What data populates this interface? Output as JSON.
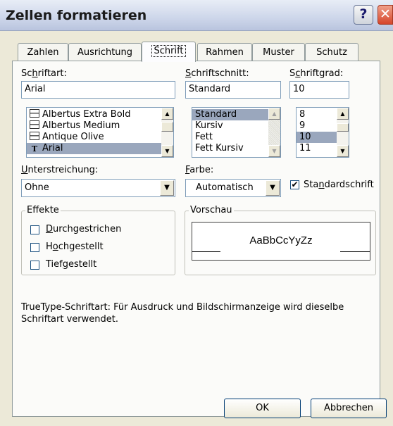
{
  "window": {
    "title": "Zellen formatieren",
    "help_glyph": "?",
    "close_glyph": "✕"
  },
  "tabs": [
    {
      "label": "Zahlen"
    },
    {
      "label": "Ausrichtung"
    },
    {
      "label": "Schrift",
      "active": true
    },
    {
      "label": "Rahmen"
    },
    {
      "label": "Muster"
    },
    {
      "label": "Schutz"
    }
  ],
  "font": {
    "label_pre": "Sc",
    "label_key": "h",
    "label_post": "riftart:",
    "value": "Arial",
    "items": [
      {
        "name": "Albertus Extra Bold",
        "icon": "printer-font-icon"
      },
      {
        "name": "Albertus Medium",
        "icon": "printer-font-icon"
      },
      {
        "name": "Antique Olive",
        "icon": "printer-font-icon"
      },
      {
        "name": "Arial",
        "icon": "truetype-font-icon",
        "selected": true
      }
    ]
  },
  "style": {
    "label_pre": "",
    "label_key": "S",
    "label_post": "chriftschnitt:",
    "value": "Standard",
    "items": [
      {
        "name": "Standard",
        "selected": true
      },
      {
        "name": "Kursiv"
      },
      {
        "name": "Fett"
      },
      {
        "name": "Fett Kursiv"
      }
    ]
  },
  "size": {
    "label_pre": "S",
    "label_key": "c",
    "label_post": "hriftgrad:",
    "value": "10",
    "items": [
      {
        "name": "8"
      },
      {
        "name": "9"
      },
      {
        "name": "10",
        "selected": true
      },
      {
        "name": "11"
      }
    ]
  },
  "underline": {
    "label_pre": "",
    "label_key": "U",
    "label_post": "nterstreichung:",
    "value": "Ohne"
  },
  "color": {
    "label_pre": "",
    "label_key": "F",
    "label_post": "arbe:",
    "value": "Automatisch"
  },
  "standard_font": {
    "label_pre": "Sta",
    "label_key": "n",
    "label_post": "dardschrift",
    "checked": true
  },
  "effects": {
    "title": "Effekte",
    "items": [
      {
        "label_pre": "",
        "label_key": "D",
        "label_post": "urchgestrichen",
        "checked": false
      },
      {
        "label_pre": "H",
        "label_key": "o",
        "label_post": "chgestellt",
        "checked": false
      },
      {
        "label_pre": "Tief",
        "label_key": "g",
        "label_post": "estellt",
        "checked": false
      }
    ]
  },
  "preview": {
    "title": "Vorschau",
    "sample": "AaBbCcYyZz"
  },
  "info_text": "TrueType-Schriftart: Für Ausdruck und Bildschirmanzeige wird dieselbe Schriftart verwendet.",
  "buttons": {
    "ok": "OK",
    "cancel": "Abbrechen"
  },
  "glyphs": {
    "up": "▲",
    "down": "▼",
    "check": "✔"
  }
}
